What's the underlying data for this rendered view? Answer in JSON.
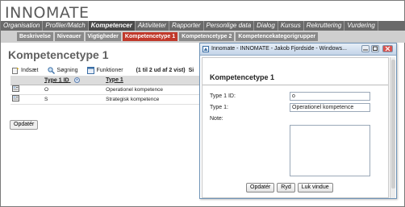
{
  "app": {
    "logo": "INNOMATE"
  },
  "main_nav": [
    {
      "label": "Organisation"
    },
    {
      "label": "Profiler/Match"
    },
    {
      "label": "Kompetencer"
    },
    {
      "label": "Aktiviteter"
    },
    {
      "label": "Rapporter"
    },
    {
      "label": "Personlige data"
    },
    {
      "label": "Dialog"
    },
    {
      "label": "Kursus"
    },
    {
      "label": "Rekruttering"
    },
    {
      "label": "Vurdering"
    }
  ],
  "sub_nav": [
    {
      "label": "Beskrivelse"
    },
    {
      "label": "Niveauer"
    },
    {
      "label": "Vigtigheder"
    },
    {
      "label": "Kompetencetype 1"
    },
    {
      "label": "Kompetencetype 2"
    },
    {
      "label": "Kompetencekategorigrupper"
    }
  ],
  "page": {
    "title": "Kompetencetype 1"
  },
  "toolbar": {
    "insert_label": "Indsæt",
    "search_label": "Søgning",
    "functions_label": "Funktioner",
    "page_info": "(1 til 2 ud af 2 vist)",
    "page_info_tail": "Si"
  },
  "table": {
    "columns": [
      "Type 1 ID",
      "Type 1"
    ],
    "rows": [
      {
        "id": "O",
        "type": "Operationel kompetence"
      },
      {
        "id": "S",
        "type": "Strategisk kompetence"
      }
    ]
  },
  "main_update_label": "Opdatér",
  "popup": {
    "window_title": "Innomate - INNOMATE - Jakob Fjordside - Windows...",
    "form_title": "Kompetencetype 1",
    "fields": {
      "type1_id_label": "Type 1 ID:",
      "type1_id_value": "o",
      "type1_label": "Type 1:",
      "type1_value": "Operationel kompetence",
      "note_label": "Note:",
      "note_value": ""
    },
    "buttons": {
      "update": "Opdatér",
      "clear": "Ryd",
      "close": "Luk vindue"
    }
  },
  "colors": {
    "active_subtab": "#c0392b",
    "nav_bar": "#6a6a6a"
  }
}
